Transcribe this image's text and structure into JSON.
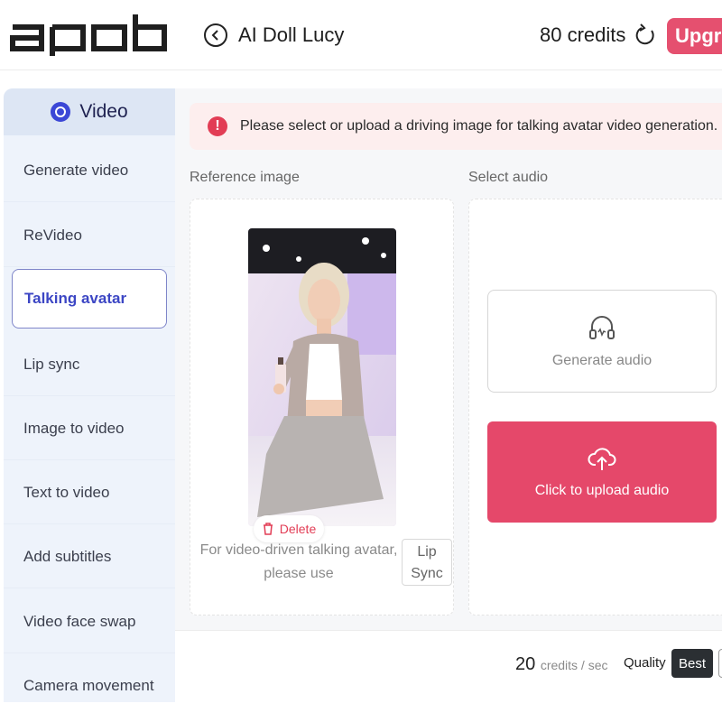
{
  "header": {
    "logo_text": "apob",
    "title": "AI Doll Lucy",
    "credits": "80 credits",
    "upgrade_label": "Upgra",
    "back_icon": "chevron-left-icon",
    "refresh_icon": "refresh-icon",
    "accent_color": "#e5506f"
  },
  "sidebar": {
    "section_label": "Video",
    "items": [
      {
        "label": "Generate video",
        "active": false
      },
      {
        "label": "ReVideo",
        "active": false
      },
      {
        "label": "Talking avatar",
        "active": true
      },
      {
        "label": "Lip sync",
        "active": false
      },
      {
        "label": "Image to video",
        "active": false
      },
      {
        "label": "Text to video",
        "active": false
      },
      {
        "label": "Add subtitles",
        "active": false
      },
      {
        "label": "Video face swap",
        "active": false
      },
      {
        "label": "Camera movement",
        "active": false
      }
    ],
    "active_color": "#3c46c4"
  },
  "alert": {
    "text": "Please select or upload a driving image for talking avatar video generation.",
    "icon": "exclamation-icon"
  },
  "reference": {
    "label": "Reference image",
    "delete_label": "Delete",
    "hint_line1": "For video-driven talking avatar,",
    "hint_line2": "please use",
    "lipsync_line1": "Lip",
    "lipsync_line2": "Sync"
  },
  "audio": {
    "label": "Select audio",
    "generate_label": "Generate audio",
    "upload_label": "Click to upload audio",
    "upload_color": "#e5486a"
  },
  "footer": {
    "cost_value": "20",
    "cost_unit": "credits / sec",
    "quality_label": "Quality",
    "quality_selected": "Best"
  }
}
